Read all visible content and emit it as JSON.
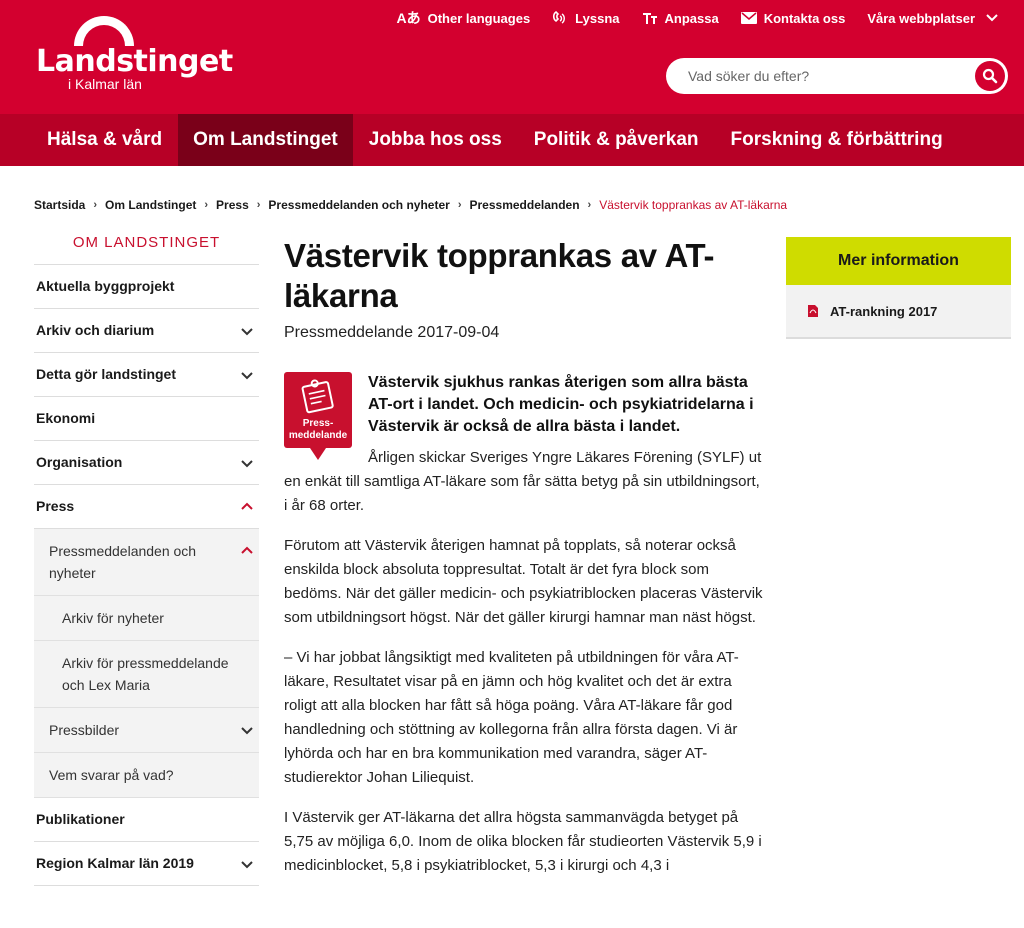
{
  "header": {
    "logo": {
      "title": "Landstinget",
      "subtitle": "i Kalmar län"
    },
    "utility": [
      {
        "icon": "translate-icon",
        "label": "Other languages"
      },
      {
        "icon": "listen-icon",
        "label": "Lyssna"
      },
      {
        "icon": "text-size-icon",
        "label": "Anpassa"
      },
      {
        "icon": "mail-icon",
        "label": "Kontakta oss"
      },
      {
        "icon": "chevron-down-icon",
        "label": "Våra webbplatser"
      }
    ],
    "search": {
      "placeholder": "Vad söker du efter?"
    },
    "colors": {
      "brand": "#d3002f",
      "nav": "#b70026",
      "nav_active": "#7a0019",
      "accent": "#cfdc00"
    }
  },
  "nav": [
    {
      "label": "Hälsa & vård",
      "active": false
    },
    {
      "label": "Om Landstinget",
      "active": true
    },
    {
      "label": "Jobba hos oss",
      "active": false
    },
    {
      "label": "Politik & påverkan",
      "active": false
    },
    {
      "label": "Forskning & förbättring",
      "active": false
    }
  ],
  "breadcrumb": [
    "Startsida",
    "Om Landstinget",
    "Press",
    "Pressmeddelanden och nyheter",
    "Pressmeddelanden",
    "Västervik topprankas av AT-läkarna"
  ],
  "sidebar": {
    "title": "OM LANDSTINGET",
    "items": [
      {
        "label": "Aktuella byggprojekt"
      },
      {
        "label": "Arkiv och diarium"
      },
      {
        "label": "Detta gör landstinget"
      },
      {
        "label": "Ekonomi"
      },
      {
        "label": "Organisation"
      },
      {
        "label": "Press"
      },
      {
        "label": "Pressmeddelanden och nyheter"
      },
      {
        "label": "Arkiv för nyheter"
      },
      {
        "label": "Arkiv för pressmeddelande och Lex Maria"
      },
      {
        "label": "Pressbilder"
      },
      {
        "label": "Vem svarar på vad?"
      },
      {
        "label": "Publikationer"
      },
      {
        "label": "Region Kalmar län 2019"
      }
    ]
  },
  "article": {
    "title": "Västervik topprankas av AT-läkarna",
    "date": "Pressmeddelande 2017-09-04",
    "badge_label": "Press-meddelande",
    "lead": "Västervik sjukhus rankas återigen som allra bästa AT-ort i landet. Och medicin- och psykiatridelarna i Västervik är också de allra bästa i landet.",
    "paragraphs": [
      "Årligen skickar Sveriges Yngre Läkares Förening (SYLF) ut en enkät till samtliga AT-läkare som får sätta betyg på sin utbildningsort, i år 68 orter.",
      "Förutom att Västervik återigen hamnat på topplats, så noterar också enskilda block absoluta toppresultat. Totalt är det fyra block som bedöms. När det gäller medicin- och psykiatriblocken placeras Västervik som utbildningsort högst. När det gäller kirurgi hamnar man näst högst.",
      "– Vi har jobbat långsiktigt med kvaliteten på utbildningen för våra AT-läkare, Resultatet visar på en jämn och hög kvalitet och det är extra roligt att alla blocken har fått så höga poäng. Våra AT-läkare får god handledning och stöttning av kollegorna från allra första dagen. Vi är lyhörda och har en bra kommunikation med varandra, säger AT-studierektor Johan Liliequist.",
      "I Västervik ger AT-läkarna det allra högsta sammanvägda betyget på 5,75 av möjliga 6,0. Inom de olika blocken får studieorten Västervik 5,9 i medicinblocket, 5,8 i psykiatriblocket, 5,3 i kirurgi och 4,3 i"
    ]
  },
  "info_panel": {
    "title": "Mer information",
    "link": "AT-rankning 2017"
  }
}
